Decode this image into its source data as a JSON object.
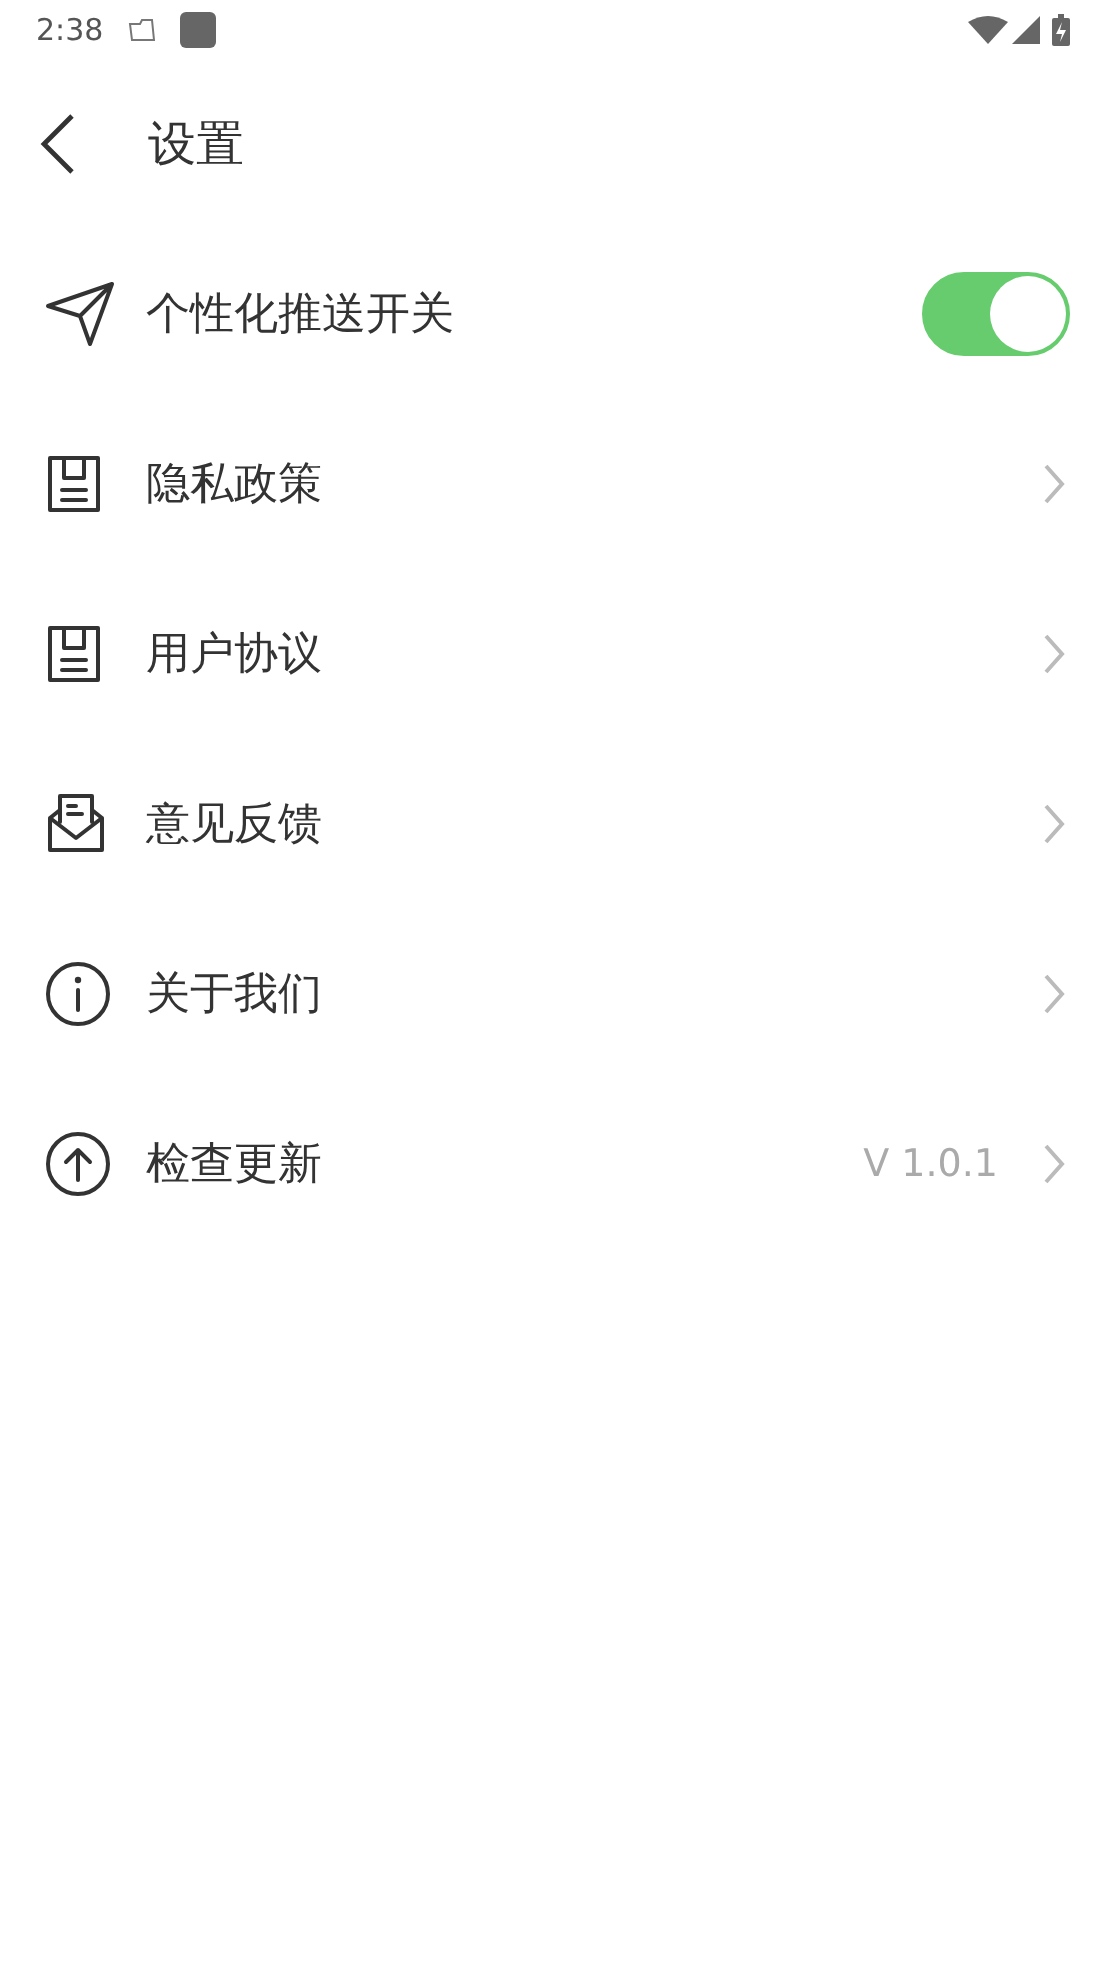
{
  "status_bar": {
    "time": "2:38"
  },
  "header": {
    "title": "设置"
  },
  "rows": [
    {
      "kind": "toggle",
      "label": "个性化推送开关",
      "on": true
    },
    {
      "kind": "link",
      "label": "隐私政策"
    },
    {
      "kind": "link",
      "label": "用户协议"
    },
    {
      "kind": "link",
      "label": "意见反馈"
    },
    {
      "kind": "link",
      "label": "关于我们"
    },
    {
      "kind": "link",
      "label": "检查更新",
      "value": "V 1.0.1"
    }
  ]
}
